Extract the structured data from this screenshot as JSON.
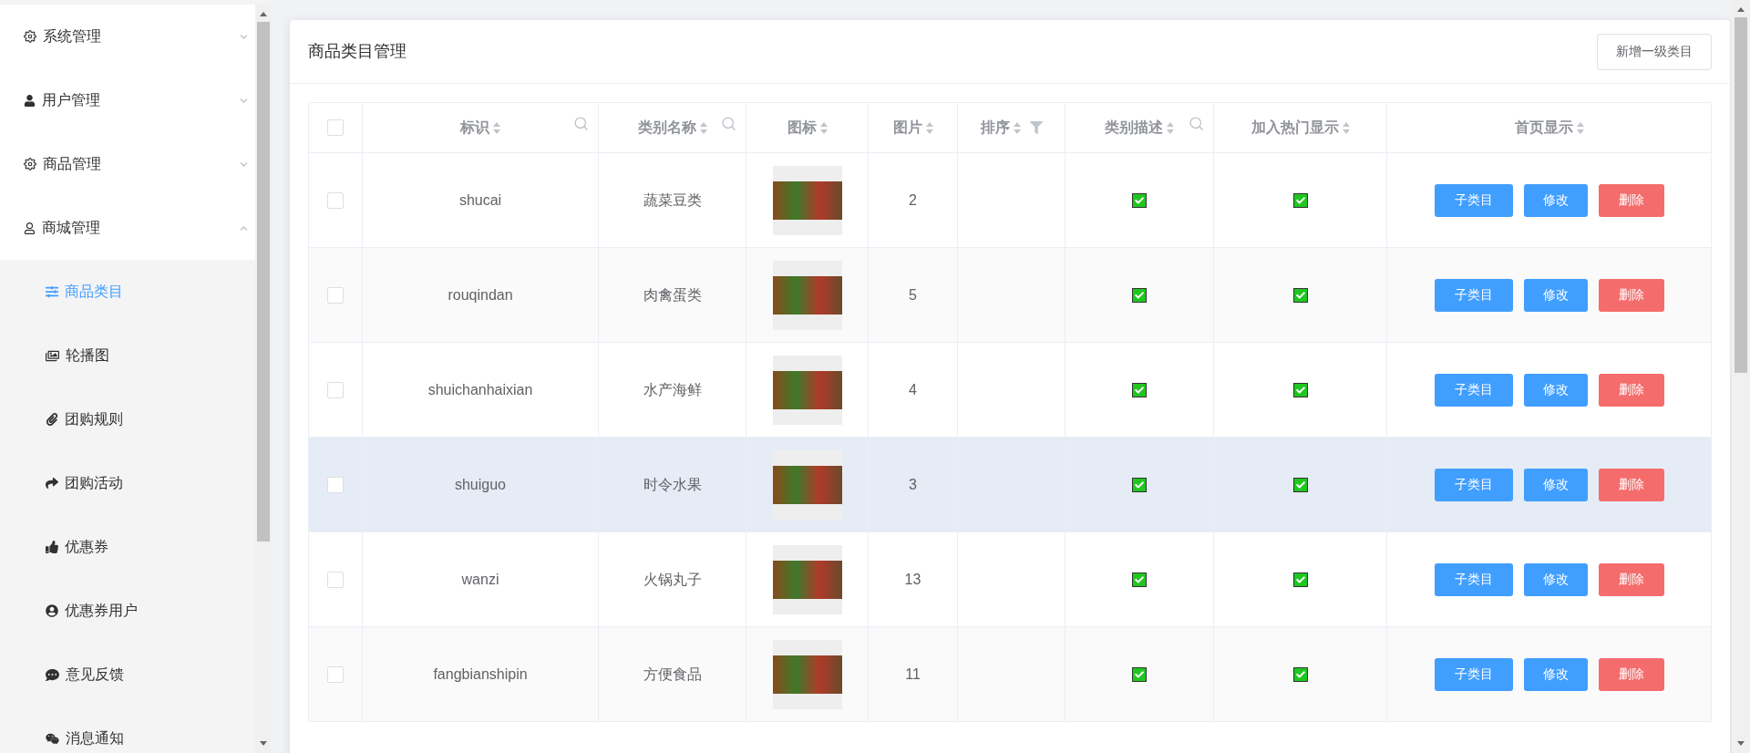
{
  "sidebar": {
    "menus": [
      {
        "label": "系统管理",
        "expanded": false
      },
      {
        "label": "用户管理",
        "expanded": false
      },
      {
        "label": "商品管理",
        "expanded": false
      },
      {
        "label": "商城管理",
        "expanded": true,
        "children": [
          {
            "label": "商品类目",
            "selected": true
          },
          {
            "label": "轮播图",
            "selected": false
          },
          {
            "label": "团购规则",
            "selected": false
          },
          {
            "label": "团购活动",
            "selected": false
          },
          {
            "label": "优惠券",
            "selected": false
          },
          {
            "label": "优惠券用户",
            "selected": false
          },
          {
            "label": "意见反馈",
            "selected": false
          },
          {
            "label": "消息通知",
            "selected": false
          }
        ]
      }
    ]
  },
  "card": {
    "title": "商品类目管理",
    "add_button": "新增一级类目"
  },
  "table": {
    "select_all_checked": false,
    "columns": [
      {
        "label": "标识",
        "kind": "search"
      },
      {
        "label": "类别名称",
        "kind": "search"
      },
      {
        "label": "图标",
        "kind": "plain"
      },
      {
        "label": "图片",
        "kind": "plain"
      },
      {
        "label": "排序",
        "kind": "filter"
      },
      {
        "label": "类别描述",
        "kind": "search"
      },
      {
        "label": "加入热门显示",
        "kind": "plain"
      },
      {
        "label": "首页显示",
        "kind": "plain"
      }
    ],
    "rows": [
      {
        "id": "shucai",
        "name": "蔬菜豆类",
        "count": "2",
        "desc_checked": true,
        "hot_checked": true,
        "highlighted": false,
        "selected": false,
        "actions": [
          "子类目",
          "修改",
          "删除"
        ]
      },
      {
        "id": "rouqindan",
        "name": "肉禽蛋类",
        "count": "5",
        "desc_checked": true,
        "hot_checked": true,
        "highlighted": false,
        "selected": false,
        "actions": [
          "子类目",
          "修改",
          "删除"
        ]
      },
      {
        "id": "shuichanhaixian",
        "name": "水产海鲜",
        "count": "4",
        "desc_checked": true,
        "hot_checked": true,
        "highlighted": false,
        "selected": false,
        "actions": [
          "子类目",
          "修改",
          "删除"
        ]
      },
      {
        "id": "shuiguo",
        "name": "时令水果",
        "count": "3",
        "desc_checked": true,
        "hot_checked": true,
        "highlighted": true,
        "selected": false,
        "actions": [
          "子类目",
          "修改",
          "删除"
        ]
      },
      {
        "id": "wanzi",
        "name": "火锅丸子",
        "count": "13",
        "desc_checked": true,
        "hot_checked": true,
        "highlighted": false,
        "selected": false,
        "actions": [
          "子类目",
          "修改",
          "删除"
        ]
      },
      {
        "id": "fangbianshipin",
        "name": "方便食品",
        "count": "11",
        "desc_checked": true,
        "hot_checked": true,
        "highlighted": false,
        "selected": false,
        "actions": [
          "子类目",
          "修改",
          "删除"
        ]
      }
    ]
  }
}
